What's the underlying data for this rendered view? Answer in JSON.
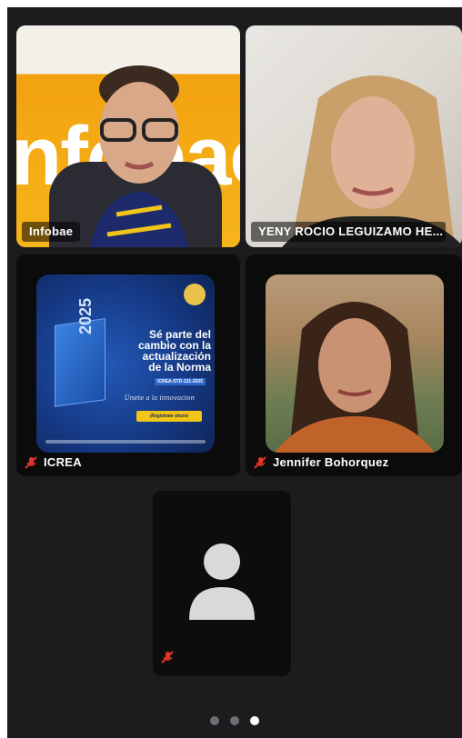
{
  "participants": [
    {
      "name": "Infobae",
      "muted": false,
      "active_speaker": true
    },
    {
      "name": "YENY ROCIO LEGUIZAMO HE...",
      "muted": false,
      "active_speaker": false
    },
    {
      "name": "ICREA",
      "muted": true,
      "active_speaker": false
    },
    {
      "name": "Jennifer Bohorquez",
      "muted": true,
      "active_speaker": false
    },
    {
      "name": "",
      "muted": true,
      "active_speaker": false
    }
  ],
  "background_text": "nfobae",
  "poster": {
    "headline_1": "Sé parte del",
    "headline_2": "cambio con la",
    "headline_3": "actualización",
    "headline_4": "de la Norma",
    "code": "ICREA-STD-131-2025",
    "year": "2025",
    "signature": "Unete a la innovacion",
    "button": "¡Regístrate ahora!"
  },
  "pagination": {
    "pages": 3,
    "current": 3
  },
  "colors": {
    "active_border": "#3ad04a",
    "muted_icon": "#e5352b",
    "background": "#1c1c1e"
  },
  "icons": [
    "mic-muted-icon",
    "person-placeholder-icon"
  ]
}
